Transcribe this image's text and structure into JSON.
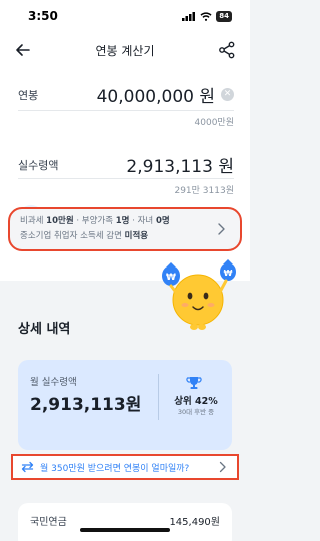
{
  "status_bar": {
    "time": "3:50",
    "battery": "84"
  },
  "nav": {
    "title": "연봉 계산기"
  },
  "salary": {
    "label": "연봉",
    "value": "40,000,000 원",
    "sub": "4000만원"
  },
  "take_home": {
    "label": "실수령액",
    "value": "2,913,113 원",
    "sub": "291만 3113원"
  },
  "settings": {
    "line1_a": "비과세 ",
    "line1_b": "10만원",
    "line1_c": " · 부양가족 ",
    "line1_d": "1명",
    "line1_e": " · 자녀 ",
    "line1_f": "0명",
    "line2_a": "중소기업 취업자 소득세 감면 ",
    "line2_b": "미적용"
  },
  "details": {
    "title": "상세 내역",
    "monthly_label": "월 실수령액",
    "monthly_value": "2,913,113원",
    "rank": "상위 42%",
    "rank_sub": "30대 후반 중"
  },
  "cta": {
    "label": "월 350만원 받으려면 연봉이 얼마일까?"
  },
  "pension": {
    "label": "국민연금",
    "value": "145,490원"
  },
  "colors": {
    "accent": "#3182f6",
    "highlight": "#e8472e",
    "summary_bg": "#dbe9ff"
  }
}
